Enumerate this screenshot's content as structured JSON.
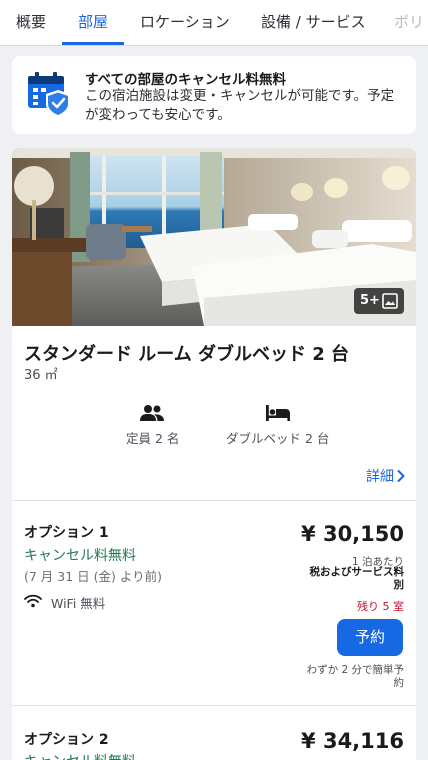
{
  "tabs": [
    {
      "label": "概要"
    },
    {
      "label": "部屋"
    },
    {
      "label": "ロケーション"
    },
    {
      "label": "設備 / サービス"
    },
    {
      "label": "ポリ"
    }
  ],
  "banner": {
    "title": "すべての部屋のキャンセル料無料",
    "text": "この宿泊施設は変更・キャンセルが可能です。予定が変わっても安心です。",
    "icon": "calendar-shield-icon"
  },
  "room": {
    "photo_count": "5+",
    "title": "スタンダード ルーム ダブルベッド 2 台",
    "size": "36 ㎡",
    "features": [
      {
        "icon": "people-icon",
        "label": "定員 2 名"
      },
      {
        "icon": "bed-icon",
        "label": "ダブルベッド 2 台"
      }
    ],
    "details_label": "詳細"
  },
  "options": [
    {
      "title": "オプション 1",
      "cancel": "キャンセル料無料",
      "date": "(7 月 31 日 (金) より前)",
      "wifi": "WiFi 無料",
      "price": "¥ 30,150",
      "per_night": "1 泊あたり",
      "tax": "税およびサービス料別",
      "remaining": "残り 5 室",
      "reserve_label": "予約",
      "quick": "わずか 2 分で簡単予約"
    },
    {
      "title": "オプション 2",
      "cancel": "キャンセル料無料",
      "price": "¥ 34,116"
    }
  ],
  "colors": {
    "accent": "#1668e3",
    "cancel_green": "#227950",
    "remaining_red": "#c8102e"
  }
}
